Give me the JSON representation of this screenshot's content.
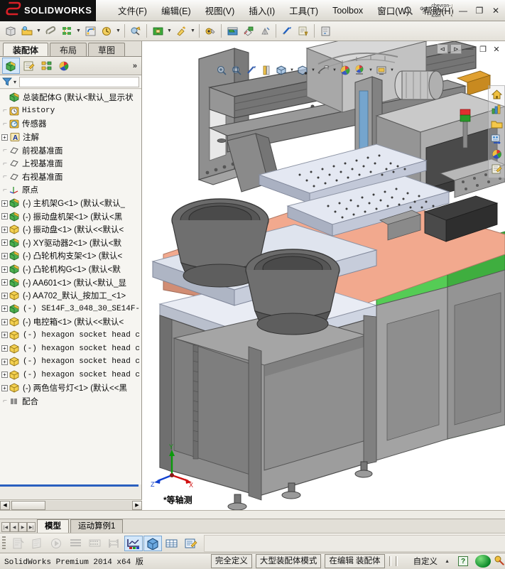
{
  "app": {
    "brand_ds": "2S",
    "brand_name": "SOLIDWORKS",
    "accent_red": "#d81f26"
  },
  "menu": {
    "items": [
      {
        "label": "文件(F)"
      },
      {
        "label": "编辑(E)"
      },
      {
        "label": "视图(V)"
      },
      {
        "label": "插入(I)"
      },
      {
        "label": "工具(T)"
      },
      {
        "label": "Toolbox"
      },
      {
        "label": "窗口(W)"
      },
      {
        "label": "帮助(H)"
      }
    ]
  },
  "window_controls": {
    "search_icon": "search-icon",
    "help_icon": "help-icon",
    "dropdown_icon": "chevron-down-icon",
    "minimize": "—",
    "maximize": "❐",
    "close": "✕"
  },
  "feature_manager": {
    "tabs": [
      {
        "label": "装配体",
        "active": true
      },
      {
        "label": "布局",
        "active": false
      },
      {
        "label": "草图",
        "active": false
      }
    ],
    "panel_icons": [
      {
        "name": "feature-tree-icon",
        "selected": true
      },
      {
        "name": "property-manager-icon",
        "selected": false
      },
      {
        "name": "configuration-manager-icon",
        "selected": false
      },
      {
        "name": "display-manager-icon",
        "selected": false
      }
    ],
    "expand_chevron": "»",
    "filter_icon": "filter-icon",
    "filter_dropdown": "▾"
  },
  "tree": {
    "root": {
      "label": "总装配体G   (默认<默认_显示状",
      "icon": "assembly-icon"
    },
    "items": [
      {
        "label": "History",
        "icon": "history-icon",
        "expand": false,
        "mono": true
      },
      {
        "label": "传感器",
        "icon": "sensor-icon",
        "expand": false,
        "mono": false
      },
      {
        "label": "注解",
        "icon": "annotation-icon",
        "expand": true,
        "mono": false
      },
      {
        "label": "前视基准面",
        "icon": "plane-icon",
        "expand": false,
        "mono": false
      },
      {
        "label": "上视基准面",
        "icon": "plane-icon",
        "expand": false,
        "mono": false
      },
      {
        "label": "右视基准面",
        "icon": "plane-icon",
        "expand": false,
        "mono": false
      },
      {
        "label": "原点",
        "icon": "origin-icon",
        "expand": false,
        "mono": false
      },
      {
        "label": "(-) 主机架G<1>  (默认<默认_",
        "icon": "part-green-icon",
        "expand": true,
        "mono": false
      },
      {
        "label": "(-) 振动盘机架<1>  (默认<黑",
        "icon": "part-green-icon",
        "expand": true,
        "mono": false
      },
      {
        "label": "(-) 振动盘<1>  (默认<<默认<",
        "icon": "part-yellow-icon",
        "expand": true,
        "mono": false
      },
      {
        "label": "(-) XY驱动器2<1>  (默认<默",
        "icon": "part-green-icon",
        "expand": true,
        "mono": false
      },
      {
        "label": "(-) 凸轮机构支架<1>  (默认<",
        "icon": "part-green-icon",
        "expand": true,
        "mono": false
      },
      {
        "label": "(-) 凸轮机构G<1>  (默认<默",
        "icon": "part-green-icon",
        "expand": true,
        "mono": false
      },
      {
        "label": "(-) AA601<1>  (默认<默认_显",
        "icon": "part-green-icon",
        "expand": true,
        "mono": false
      },
      {
        "label": "(-) AA702_默认_按加工_<1>",
        "icon": "part-yellow-icon",
        "expand": true,
        "mono": false
      },
      {
        "label": "(-) SE14F_3_048_30_SE14F-",
        "icon": "part-green-icon",
        "expand": true,
        "mono": false
      },
      {
        "label": "(-) 电控箱<1>  (默认<<默认<",
        "icon": "part-yellow-icon",
        "expand": true,
        "mono": false
      },
      {
        "label": "(-) hexagon socket head c",
        "icon": "part-yellow-icon",
        "expand": true,
        "mono": true
      },
      {
        "label": "(-) hexagon socket head c",
        "icon": "part-yellow-icon",
        "expand": true,
        "mono": true
      },
      {
        "label": "(-) hexagon socket head c",
        "icon": "part-yellow-icon",
        "expand": true,
        "mono": true
      },
      {
        "label": "(-) hexagon socket head c",
        "icon": "part-yellow-icon",
        "expand": true,
        "mono": true
      },
      {
        "label": "(-) 两色信号灯<1>  (默认<<黑",
        "icon": "part-yellow-icon",
        "expand": true,
        "mono": false
      }
    ],
    "mates": {
      "label": "配合",
      "icon": "mates-icon"
    }
  },
  "toolbar": {
    "buttons": [
      {
        "name": "new-document-icon"
      },
      {
        "name": "open-document-icon",
        "has_arrow": true
      },
      {
        "name": "save-icon"
      },
      {
        "name": "print-icon",
        "has_arrow": true
      },
      {
        "name": "undo-icon"
      },
      {
        "name": "redo-icon",
        "has_arrow": true
      },
      {
        "name": "select-icon",
        "sep_before": true
      },
      {
        "name": "rebuild-icon",
        "sep_before": true,
        "has_arrow": true
      },
      {
        "name": "options-icon",
        "has_arrow": true
      },
      {
        "name": "edit-appearance-icon",
        "sep_before": true
      },
      {
        "name": "section-view-icon",
        "sep_before": true
      },
      {
        "name": "measure-icon"
      },
      {
        "name": "mass-properties-icon"
      },
      {
        "name": "interference-icon",
        "sep_before": true
      },
      {
        "name": "assembly-visualization-icon"
      },
      {
        "name": "sheet-metal-icon",
        "sep_before": true
      }
    ]
  },
  "viewport": {
    "orientation_label": "*等轴测",
    "doc_buttons": [
      "⊲",
      "⊳",
      "—",
      "❐",
      "✕"
    ],
    "float_toolbar": [
      {
        "name": "zoom-to-fit-icon"
      },
      {
        "name": "zoom-area-icon"
      },
      {
        "name": "previous-view-icon"
      },
      {
        "name": "section-view-icon"
      },
      {
        "name": "view-orientation-icon",
        "has_arrow": true
      },
      {
        "name": "display-style-icon",
        "has_arrow": true
      },
      {
        "name": "hide-show-icon",
        "has_arrow": true
      },
      {
        "name": "edit-appearance-icon"
      },
      {
        "name": "apply-scene-icon",
        "has_arrow": true
      },
      {
        "name": "view-settings-icon",
        "has_arrow": true
      }
    ],
    "triad": {
      "x": "X",
      "y": "Y",
      "z": "Z",
      "x_color": "#d01010",
      "y_color": "#0a9a0a",
      "z_color": "#1040d0"
    },
    "model_colors": {
      "table_top": "#f2a98e",
      "machine_gray": "#9a9a9a",
      "dark_gray": "#6e6e6e",
      "panel_green": "#55cc55",
      "light_plate": "#ccd3e2",
      "background": "#ffffff"
    }
  },
  "right_strip": {
    "icons": [
      {
        "name": "home-icon"
      },
      {
        "name": "design-library-icon"
      },
      {
        "name": "file-explorer-icon"
      },
      {
        "name": "view-palette-icon"
      },
      {
        "name": "appearances-icon"
      },
      {
        "name": "custom-properties-icon"
      }
    ]
  },
  "motion_study": {
    "nav_buttons": [
      "|◀",
      "◀",
      "▶",
      "▶|"
    ],
    "tabs": [
      {
        "label": "模型",
        "active": true
      },
      {
        "label": "运动算例1",
        "active": false
      }
    ],
    "toolbar_icons": [
      {
        "name": "calculate-icon",
        "disabled": true
      },
      {
        "name": "playback-mode-icon",
        "disabled": true
      },
      {
        "name": "play-icon",
        "disabled": true
      },
      {
        "name": "animation-wizard-icon",
        "disabled": true
      },
      {
        "name": "keyframe-icon",
        "disabled": true
      },
      {
        "name": "motor-icon",
        "disabled": true
      },
      {
        "name": "results-plot-icon",
        "disabled": false,
        "selected": true
      },
      {
        "name": "collision-check-icon",
        "disabled": false,
        "selected": true
      },
      {
        "name": "grid-icon",
        "disabled": false
      },
      {
        "name": "save-animation-icon",
        "disabled": false
      }
    ]
  },
  "status_bar": {
    "product": "SolidWorks Premium 2014 x64 版",
    "cells": [
      {
        "label": "完全定义"
      },
      {
        "label": "大型装配体模式"
      },
      {
        "label": "在编辑 装配体"
      }
    ],
    "custom_label": "自定义",
    "up_arrow": "▲",
    "help_badge": "?",
    "sphere_icon": "sphere-icon",
    "pen_icon": "pen-icon"
  }
}
